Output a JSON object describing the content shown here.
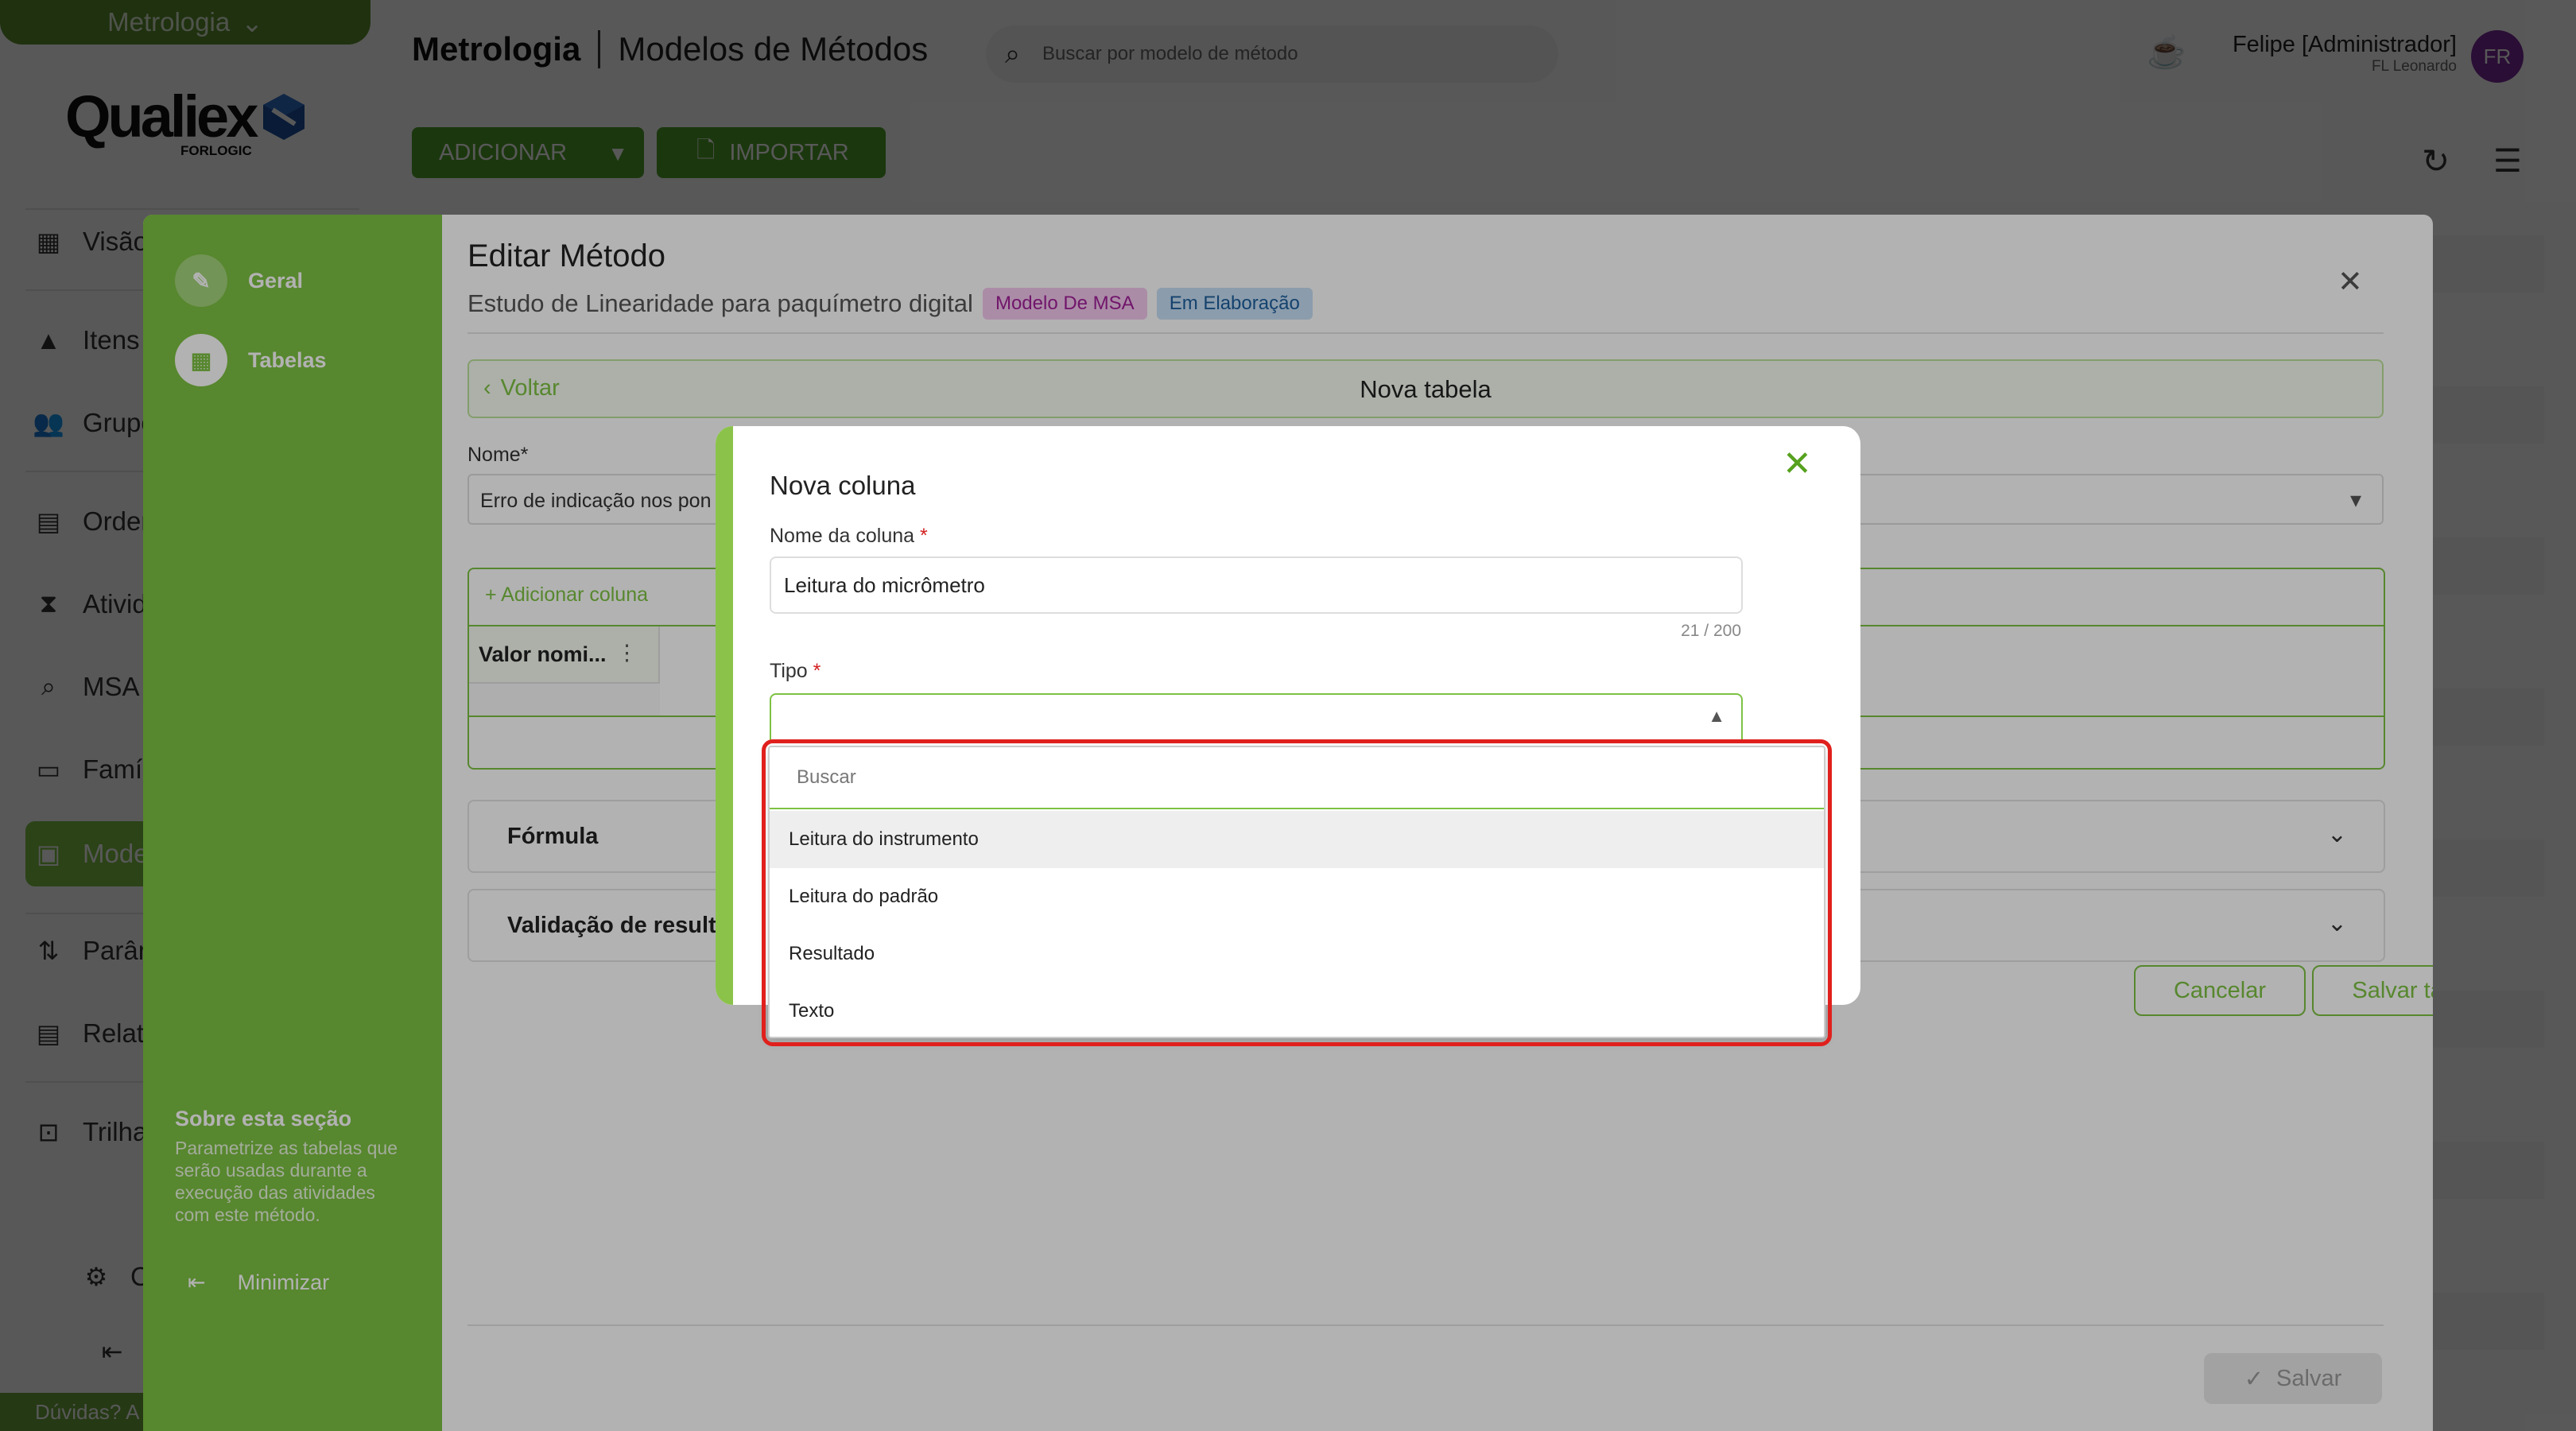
{
  "app": {
    "module": "Metrologia",
    "logo_text": "Qualiex",
    "logo_sub": "FORLOGIC",
    "nav": [
      "Visão",
      "Itens",
      "Grupo",
      "Orden",
      "Ativid",
      "MSA",
      "Famíl",
      "Mode",
      "Parâm",
      "Relat",
      "Trilha"
    ],
    "footer_help": "Dúvidas? A",
    "settings_short": "C"
  },
  "header": {
    "module": "Metrologia",
    "page": "Modelos de Métodos",
    "search_placeholder": "Buscar por modelo de método",
    "user_name": "Felipe [Administrador]",
    "user_company": "FL Leonardo",
    "avatar": "FR"
  },
  "toolbar": {
    "add": "ADICIONAR",
    "import": "IMPORTAR"
  },
  "edit_modal": {
    "sidebar": {
      "general": "Geral",
      "tables": "Tabelas",
      "about_title": "Sobre esta seção",
      "about_text": "Parametrize as tabelas que serão usadas durante a execução das atividades com este método.",
      "minimize": "Minimizar"
    },
    "title": "Editar Método",
    "subtitle": "Estudo de Linearidade para paquímetro digital",
    "tag_model": "Modelo De MSA",
    "tag_status": "Em Elaboração",
    "back": "Voltar",
    "new_table": "Nova tabela",
    "name_label": "Nome*",
    "name_value": "Erro de indicação nos pon",
    "add_column": "+ Adicionar coluna",
    "column_header": "Valor nomi...",
    "formula": "Fórmula",
    "validation": "Validação de result",
    "cancel": "Cancelar",
    "save_table": "Salvar tabela",
    "save": "Salvar"
  },
  "new_column": {
    "title": "Nova coluna",
    "name_label": "Nome da coluna",
    "name_value": "Leitura do micrômetro",
    "counter": "21 / 200",
    "type_label": "Tipo",
    "search_placeholder": "Buscar",
    "options": [
      "Leitura do instrumento",
      "Leitura do padrão",
      "Resultado",
      "Texto"
    ]
  },
  "colors": {
    "accent": "#7dc243",
    "danger": "#e0201d"
  }
}
